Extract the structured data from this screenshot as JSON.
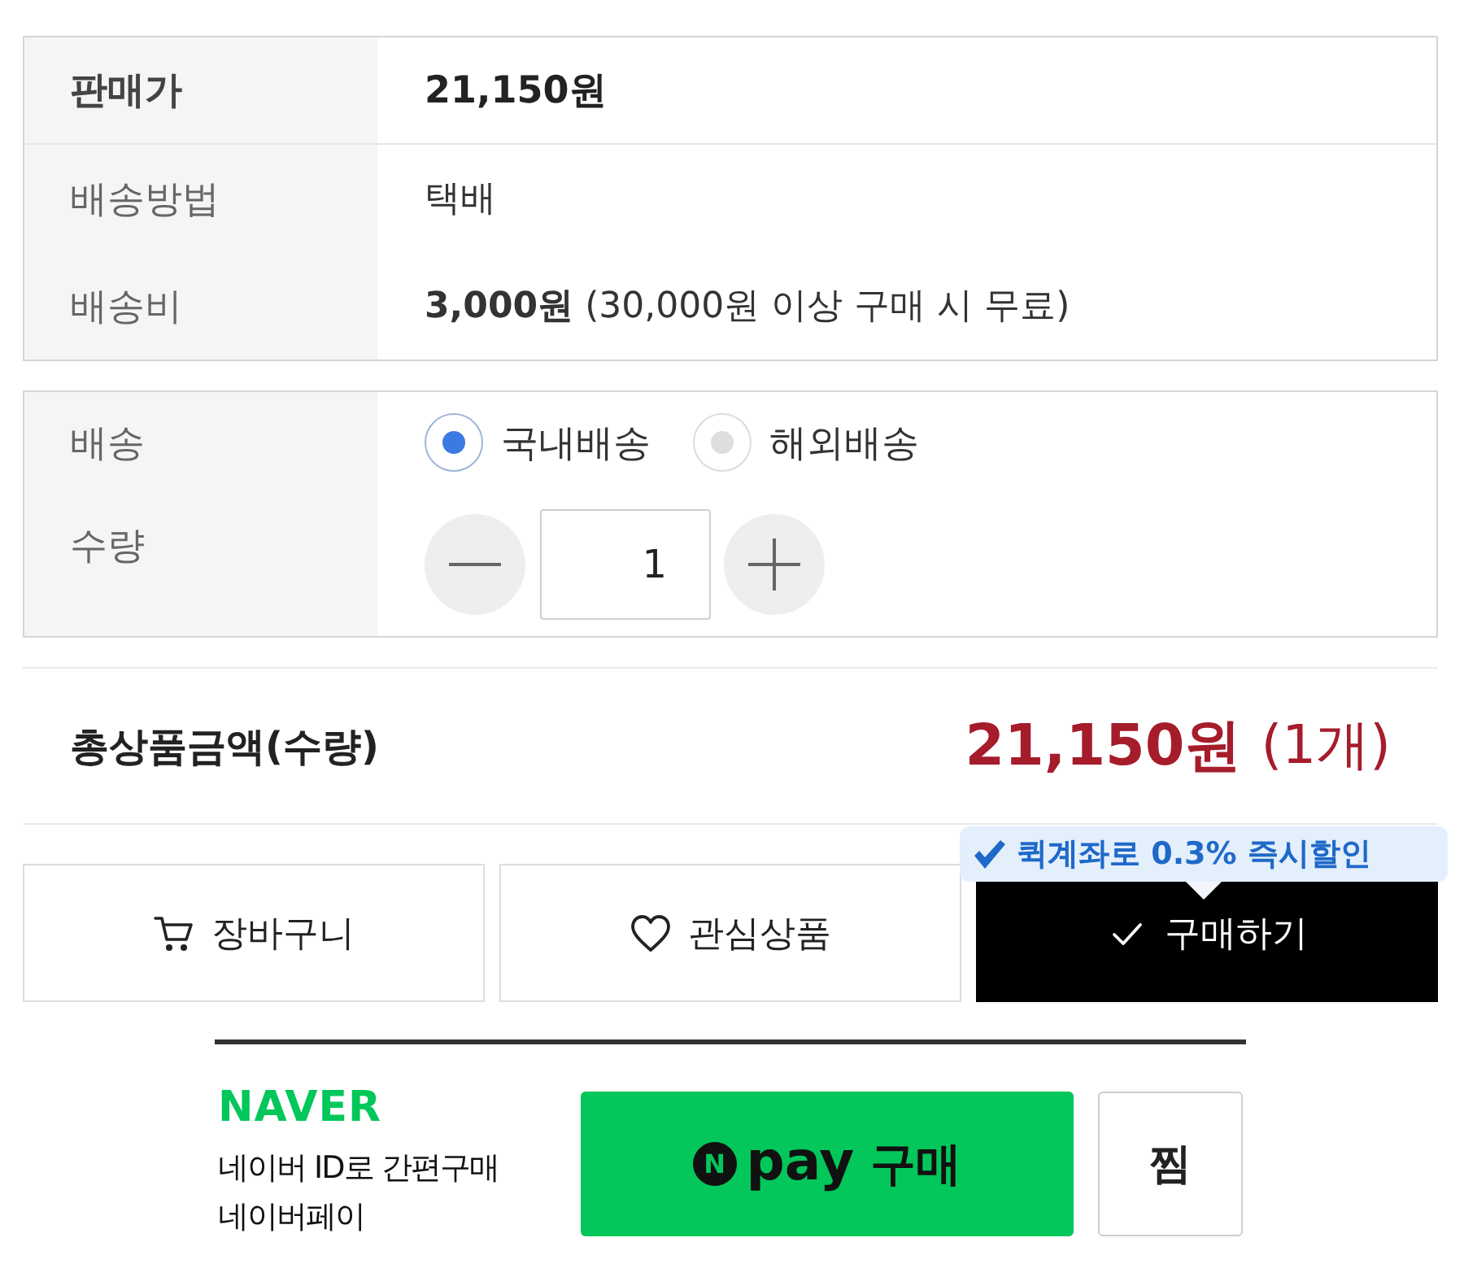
{
  "price_table": {
    "rows": [
      {
        "label": "판매가",
        "value": "21,150원",
        "kind": "price"
      },
      {
        "label": "배송방법",
        "value": "택배",
        "kind": "plain"
      },
      {
        "label": "배송비",
        "value": "**3,000원** (30,000원 이상 구매 시 무료)",
        "kind": "plain"
      }
    ]
  },
  "options": {
    "shipping": {
      "label": "배송",
      "choices": [
        {
          "label": "국내배송",
          "selected": true
        },
        {
          "label": "해외배송",
          "selected": false
        }
      ]
    },
    "quantity": {
      "label": "수량",
      "value": "1"
    }
  },
  "total": {
    "label": "총상품금액(수량)",
    "amount": "21,150원",
    "count": "(1개)"
  },
  "actions": {
    "promo": "퀵계좌로 0.3% 즉시할인",
    "buttons": [
      {
        "kind": "cart",
        "label": "장바구니"
      },
      {
        "kind": "wishlist",
        "label": "관심상품"
      },
      {
        "kind": "buy",
        "label": "구매하기"
      }
    ]
  },
  "naver_pay": {
    "logo": "NAVER",
    "lines": [
      "네이버 ID로 간편구매",
      "네이버페이"
    ],
    "pay_button": {
      "badge": "N",
      "brand": "pay",
      "label": "구매"
    },
    "wish_button": {
      "label": "찜"
    }
  }
}
